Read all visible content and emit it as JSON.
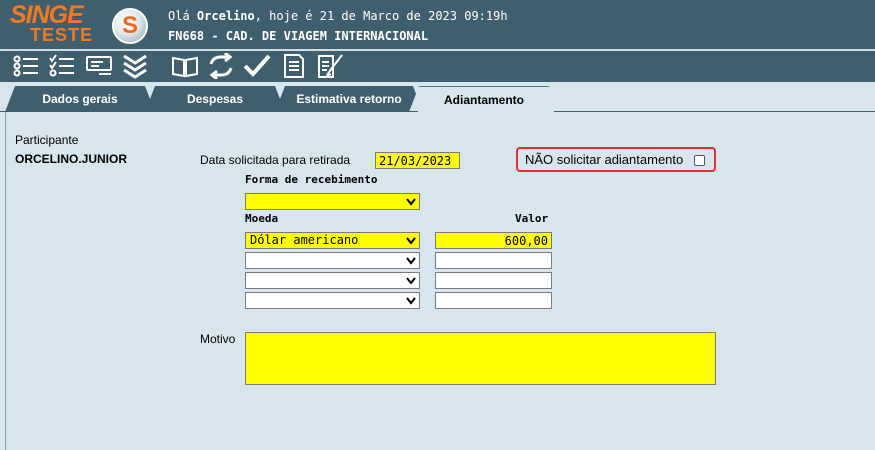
{
  "header": {
    "logo_main": "SINGE",
    "logo_sub": "TESTE",
    "brand_letter": "S",
    "greeting_prefix": "Olá",
    "user_name": "Orcelino",
    "greeting_suffix": ", hoje é 21 de Marco de 2023 09:19h",
    "screen_title": "FN668 - CAD. DE VIAGEM INTERNACIONAL"
  },
  "toolbar": {
    "icons": [
      "list-icon",
      "checklist-icon",
      "form-card-icon",
      "chevrons-down-icon",
      "book-icon",
      "refresh-arrows-icon",
      "checkmark-icon",
      "document-icon",
      "edit-document-icon"
    ]
  },
  "tabs": [
    {
      "label": "Dados gerais",
      "active": false
    },
    {
      "label": "Despesas",
      "active": false
    },
    {
      "label": "Estimativa retorno",
      "active": false
    },
    {
      "label": "Adiantamento",
      "active": true
    }
  ],
  "form": {
    "participant_label": "Participante",
    "participant_value": "ORCELINO.JUNIOR",
    "date_label": "Data solicitada para retirada",
    "date_value": "21/03/2023",
    "no_advance_label": "NÃO solicitar adiantamento",
    "no_advance_checked": false,
    "payment_form_label": "Forma de recebimento",
    "payment_form_value": "",
    "currency_header": "Moeda",
    "amount_header": "Valor",
    "currency_rows": [
      {
        "currency": "Dólar americano",
        "amount": "600,00"
      },
      {
        "currency": "",
        "amount": ""
      },
      {
        "currency": "",
        "amount": ""
      },
      {
        "currency": "",
        "amount": ""
      }
    ],
    "reason_label": "Motivo",
    "reason_value": ""
  },
  "colors": {
    "header_bg": "#3f5f6f",
    "content_bg": "#d6e6ec",
    "logo_orange": "#f47a20",
    "required_field": "#ffff00",
    "highlight_red": "#e0302e"
  }
}
